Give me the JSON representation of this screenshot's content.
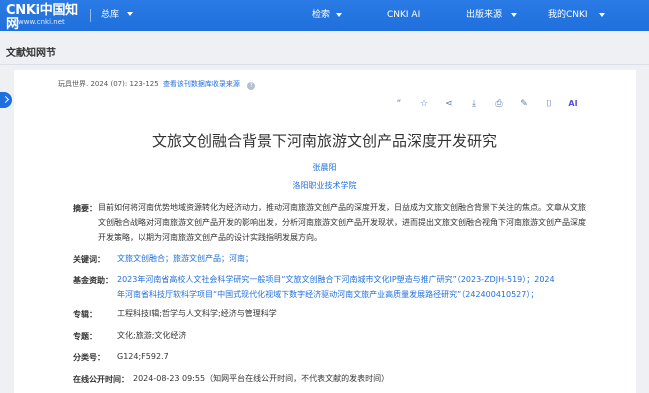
{
  "nav": {
    "logo_text": "CNKi中国知网",
    "logo_url": "www.cnki.net",
    "library": "总库",
    "items": [
      {
        "label": "检索",
        "has_caret": true
      },
      {
        "label": "CNKI AI",
        "has_caret": false
      },
      {
        "label": "出版来源",
        "has_caret": true
      },
      {
        "label": "我的CNKI",
        "has_caret": true
      }
    ]
  },
  "page": {
    "section_title": "文献知网节"
  },
  "article": {
    "source_journal": "玩具世界",
    "source_issue": ". 2024 (07)",
    "source_pages": ": 123-125",
    "source_link": "查看该刊数据库收录来源",
    "title": "文旅文创融合背景下河南旅游文创产品深度开发研究",
    "author": "张晨阳",
    "organization": "洛阳职业技术学院",
    "abstract_label": "摘要：",
    "abstract": "目前如何将河南优势地域资源转化为经济动力，推动河南旅游文创产品的深度开发，日益成为文旅文创融合背景下关注的焦点。文章从文旅文创融合战略对河南旅游文创产品开发的影响出发，分析河南旅游文创产品开发现状，进而提出文旅文创融合视角下河南旅游文创产品深度开发策略，以期为河南旅游文创产品的设计实践指明发展方向。",
    "keywords_label": "关键词：",
    "keywords": "文旅文创融合；旅游文创产品；河南；",
    "fund_label": "基金资助：",
    "fund_line1": "2023年河南省高校人文社会科学研究一般项目“文旅文创融合下河南城市文化IP塑造与推广研究”（2023-ZDJH-519）；2024",
    "fund_line2": "年河南省科技厅软科学项目“中国式现代化视域下数字经济驱动河南文旅产业高质量发展路径研究”（242400410527）；",
    "subject_label": "专辑：",
    "subject": "工程科技Ⅰ辑;哲学与人文科学;经济与管理科学",
    "topic_label": "专题：",
    "topic": "文化;旅游;文化经济",
    "class_label": "分类号：",
    "class_no": "G124;F592.7",
    "online_label": "在线公开时间：",
    "online_time": "2024-08-23 09:55（知网平台在线公开时间，不代表文献的发表时间）"
  },
  "toolbar": {
    "icons": [
      "quote-icon",
      "star-icon",
      "share-icon",
      "download-icon",
      "print-icon",
      "edit-icon",
      "read-icon",
      "ai-icon"
    ],
    "glyphs": [
      "“",
      "☆",
      "⋖",
      "⤓",
      "⎙",
      "✎",
      "⌷",
      "AI"
    ]
  },
  "colors": {
    "nav_bg": "#1f6fdc",
    "link": "#1f6fdc",
    "ai": "#5a4fd6",
    "page_bg": "#eef0f4"
  }
}
